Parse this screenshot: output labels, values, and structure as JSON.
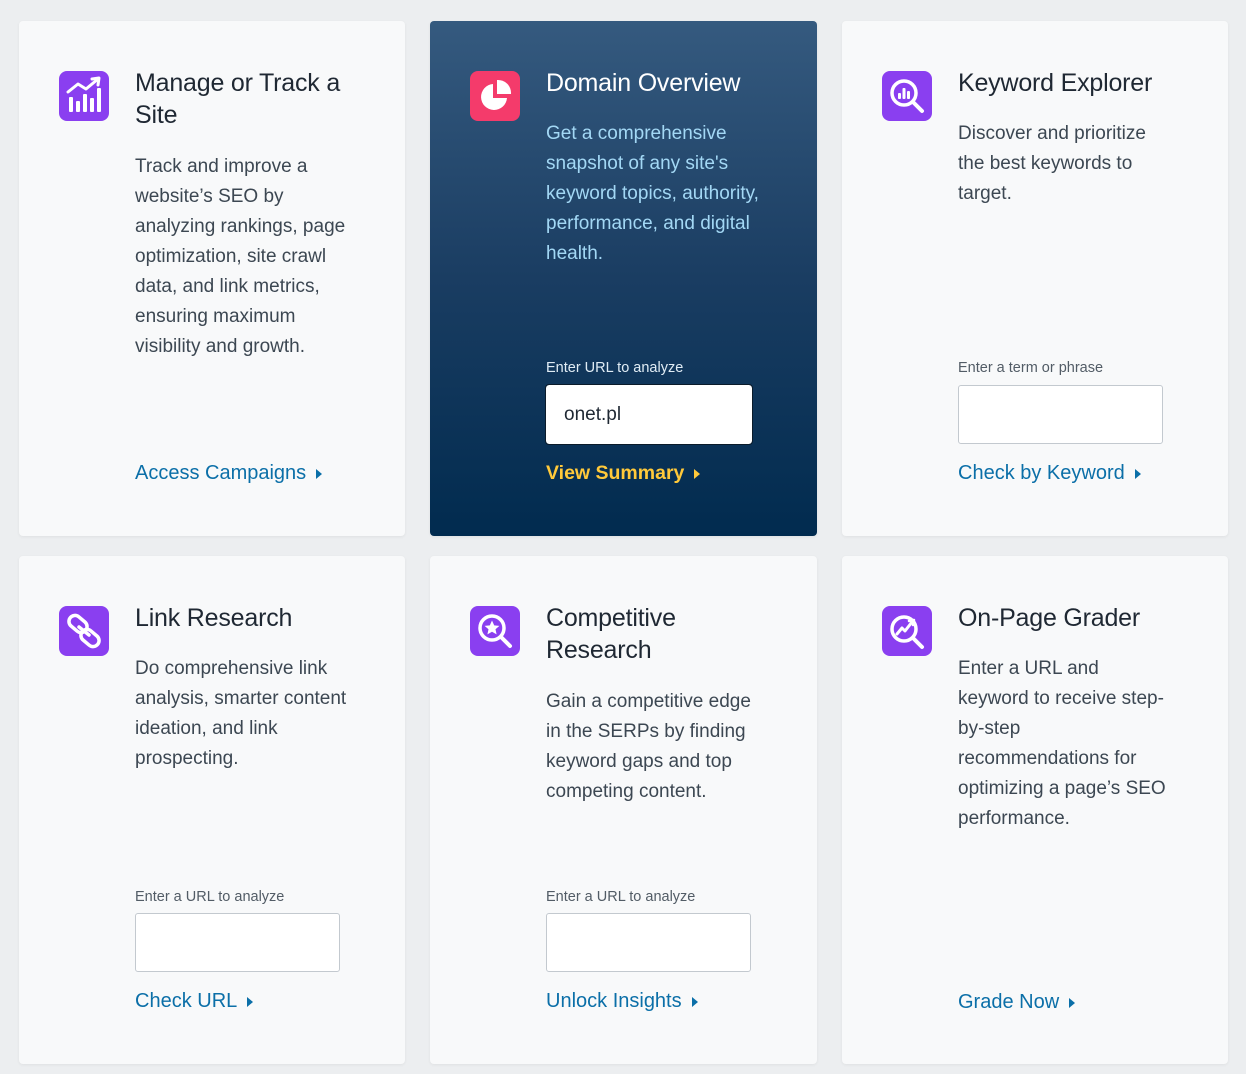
{
  "cards": [
    {
      "title": "Manage or Track a Site",
      "description": "Track and improve a website’s SEO by analyzing rankings, page optimization, site crawl data, and link metrics, ensuring maximum visibility and growth.",
      "cta": "Access Campaigns",
      "icon": "bar-chart-icon"
    },
    {
      "title": "Domain Overview",
      "description": "Get a comprehensive snapshot of any site's keyword topics, authority, performance, and digital health.",
      "field_label": "Enter URL to analyze",
      "field_value": "onet.pl",
      "cta": "View Summary",
      "icon": "pie-chart-icon"
    },
    {
      "title": "Keyword Explorer",
      "description": "Discover and prioritize the best keywords to target.",
      "field_label": "Enter a term or phrase",
      "field_value": "",
      "cta": "Check by Keyword",
      "icon": "search-chart-icon"
    },
    {
      "title": "Link Research",
      "description": "Do comprehensive link analysis, smarter content ideation, and link prospecting.",
      "field_label": "Enter a URL to analyze",
      "field_value": "",
      "cta": "Check URL",
      "icon": "link-icon"
    },
    {
      "title": "Competitive Research",
      "description": "Gain a competitive edge in the SERPs by finding keyword gaps and top competing content.",
      "field_label": "Enter a URL to analyze",
      "field_value": "",
      "cta": "Unlock Insights",
      "icon": "search-star-icon"
    },
    {
      "title": "On-Page Grader",
      "description": "Enter a URL and keyword to receive step-by-step recommendations for optimizing a page’s SEO performance.",
      "cta": "Grade Now",
      "icon": "grader-icon"
    }
  ],
  "colors": {
    "accent_purple": "#8a3ff0",
    "accent_pink": "#f43b6b",
    "link_blue": "#0b6fa8",
    "cta_yellow": "#ffc93a",
    "dark_card_top": "#355a7f",
    "dark_card_bottom": "#012b4f"
  }
}
